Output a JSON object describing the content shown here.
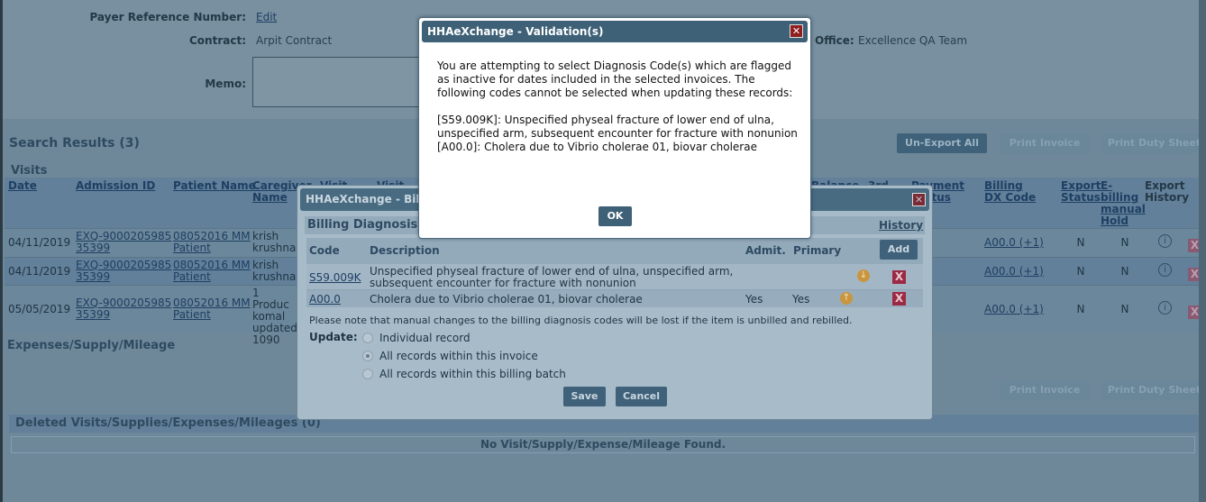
{
  "form": {
    "payer_ref_label": "Payer Reference Number:",
    "payer_ref_link": "Edit",
    "contract_label": "Contract:",
    "contract_value": "Arpit Contract",
    "office_label": "Office:",
    "office_value": "Excellence QA Team",
    "memo_label": "Memo:",
    "memo_value": ""
  },
  "results": {
    "title": "Search Results  (3)",
    "buttons": [
      "Un-Export All",
      "Print Invoice",
      "Print Duty Sheet"
    ],
    "visits_title": "Visits",
    "columns": [
      "Date",
      "Admission ID",
      "Patient Name",
      "Caregiver Name",
      "Visit",
      "Visit",
      "Balance",
      "3rd",
      "Payment Status",
      "Billing DX Code",
      "Export Status",
      "E-billing manual Hold",
      "Export History"
    ],
    "rows": [
      {
        "date": "04/11/2019",
        "admission": "EXQ-900020598535399",
        "patient": "08052016 MM Patient",
        "caregiver": "krish krushna",
        "dx": "A00.0 (+1)",
        "export_status": "N",
        "ebilling": "N"
      },
      {
        "date": "04/11/2019",
        "admission": "EXQ-900020598535399",
        "patient": "08052016 MM Patient",
        "caregiver": "krish krushna",
        "dx": "A00.0 (+1)",
        "export_status": "N",
        "ebilling": "N"
      },
      {
        "date": "05/05/2019",
        "admission": "EXQ-900020598535399",
        "patient": "08052016 MM Patient",
        "caregiver": "1 Produc komal updated 1090",
        "dx": "A00.0 (+1)",
        "export_status": "N",
        "ebilling": "N"
      }
    ],
    "expenses_title": "Expenses/Supply/Mileage",
    "buttons2": [
      "Print Invoice",
      "Print Duty Sheet"
    ],
    "deleted_title": "Deleted Visits/Supplies/Expenses/Mileages  (0)",
    "deleted_empty": "No Visit/Supply/Expense/Mileage Found."
  },
  "billing_modal": {
    "title": "HHAeXchange - Billing Diagnosis",
    "section": "Billing Diagnosis",
    "history": "History",
    "col_code": "Code",
    "col_desc": "Description",
    "col_admit": "Admit.",
    "col_primary": "Primary",
    "add": "Add",
    "rows": [
      {
        "code": "S59.009K",
        "desc": "Unspecified physeal fracture of lower end of ulna, unspecified arm, subsequent encounter for fracture with nonunion",
        "admit": "",
        "primary": ""
      },
      {
        "code": "A00.0",
        "desc": "Cholera due to Vibrio cholerae 01, biovar cholerae",
        "admit": "Yes",
        "primary": "Yes"
      }
    ],
    "note": "Please note that manual changes to the billing diagnosis codes will be lost if the item is unbilled and rebilled.",
    "update_label": "Update:",
    "options": [
      "Individual record",
      "All records within this invoice",
      "All records within this billing batch"
    ],
    "selected_option": "All records within this invoice",
    "save": "Save",
    "cancel": "Cancel"
  },
  "validation_modal": {
    "title": "HHAeXchange - Validation(s)",
    "message": "You are attempting to select Diagnosis Code(s) which are flagged as inactive for dates included in the selected invoices. The following codes cannot be selected when updating these records:",
    "code1": "[S59.009K]: Unspecified physeal fracture of lower end of ulna, unspecified arm, subsequent encounter for fracture with nonunion",
    "code2": "[A00.0]: Cholera due to Vibrio cholerae 01, biovar cholerae",
    "ok": "OK"
  },
  "icons": {
    "close": "close-icon",
    "info": "info-icon",
    "delete": "delete-x-icon",
    "arrow_down": "arrow-down-circle-icon",
    "arrow_up": "arrow-up-circle-icon"
  }
}
